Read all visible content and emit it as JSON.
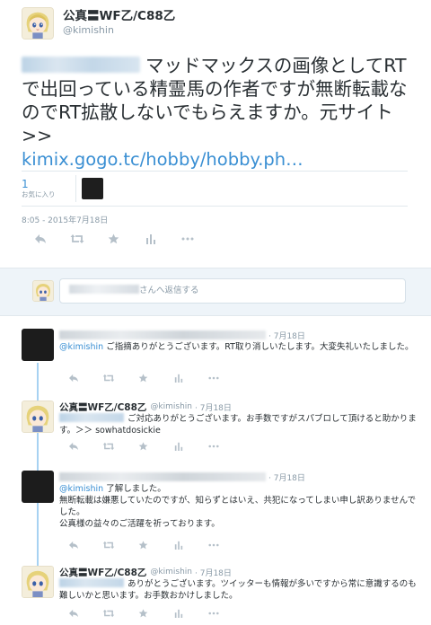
{
  "tweet": {
    "author_name": "公真〓WF乙/C88乙",
    "author_handle": "@kimishin",
    "text": "マッドマックスの画像としてRTで出回っている精霊馬の作者ですが無断転載なのでRT拡散しないでもらえますか。元サイト>>",
    "link_text": "kimix.gogo.tc/hobby/hobby.ph…",
    "favorites_count": "1",
    "favorites_label": "お気に入り",
    "timestamp": "8:05 - 2015年7月18日"
  },
  "reply_box": {
    "placeholder_suffix": "さんへ返信する"
  },
  "replies": [
    {
      "time": "· 7月18日",
      "mention": "@kimishin",
      "text": " ご指摘ありがとうございます。RT取り消しいたします。大変失礼いたしました。"
    },
    {
      "name": "公真〓WF乙/C88乙",
      "handle": "@kimishin",
      "time": "· 7月18日",
      "text": "ご対応ありがとうございます。お手数ですがスパブロして頂けると助かります。＞＞ sowhatdosickie"
    },
    {
      "time": "· 7月18日",
      "mention": "@kimishin",
      "text_line1": " 了解しました。",
      "text_line2": "無断転載は嫌悪していたのですが、知らずとはいえ、共犯になってしまい申し訳ありませんでした。",
      "text_line3": "公真様の益々のご活躍を祈っております。"
    },
    {
      "name": "公真〓WF乙/C88乙",
      "handle": "@kimishin",
      "time": "· 7月18日",
      "text": "ありがとうございます。ツイッターも情報が多いですから常に意識するのも難しいかと思います。お手数おかけしました。"
    }
  ],
  "actions": [
    "reply-icon",
    "retweet-icon",
    "favorite-icon",
    "analytics-icon",
    "more-icon"
  ],
  "colors": {
    "link": "#3a8fd3",
    "muted": "#8899a6",
    "thread_line": "#a7d2f2",
    "reply_bg": "#eef4f9"
  }
}
